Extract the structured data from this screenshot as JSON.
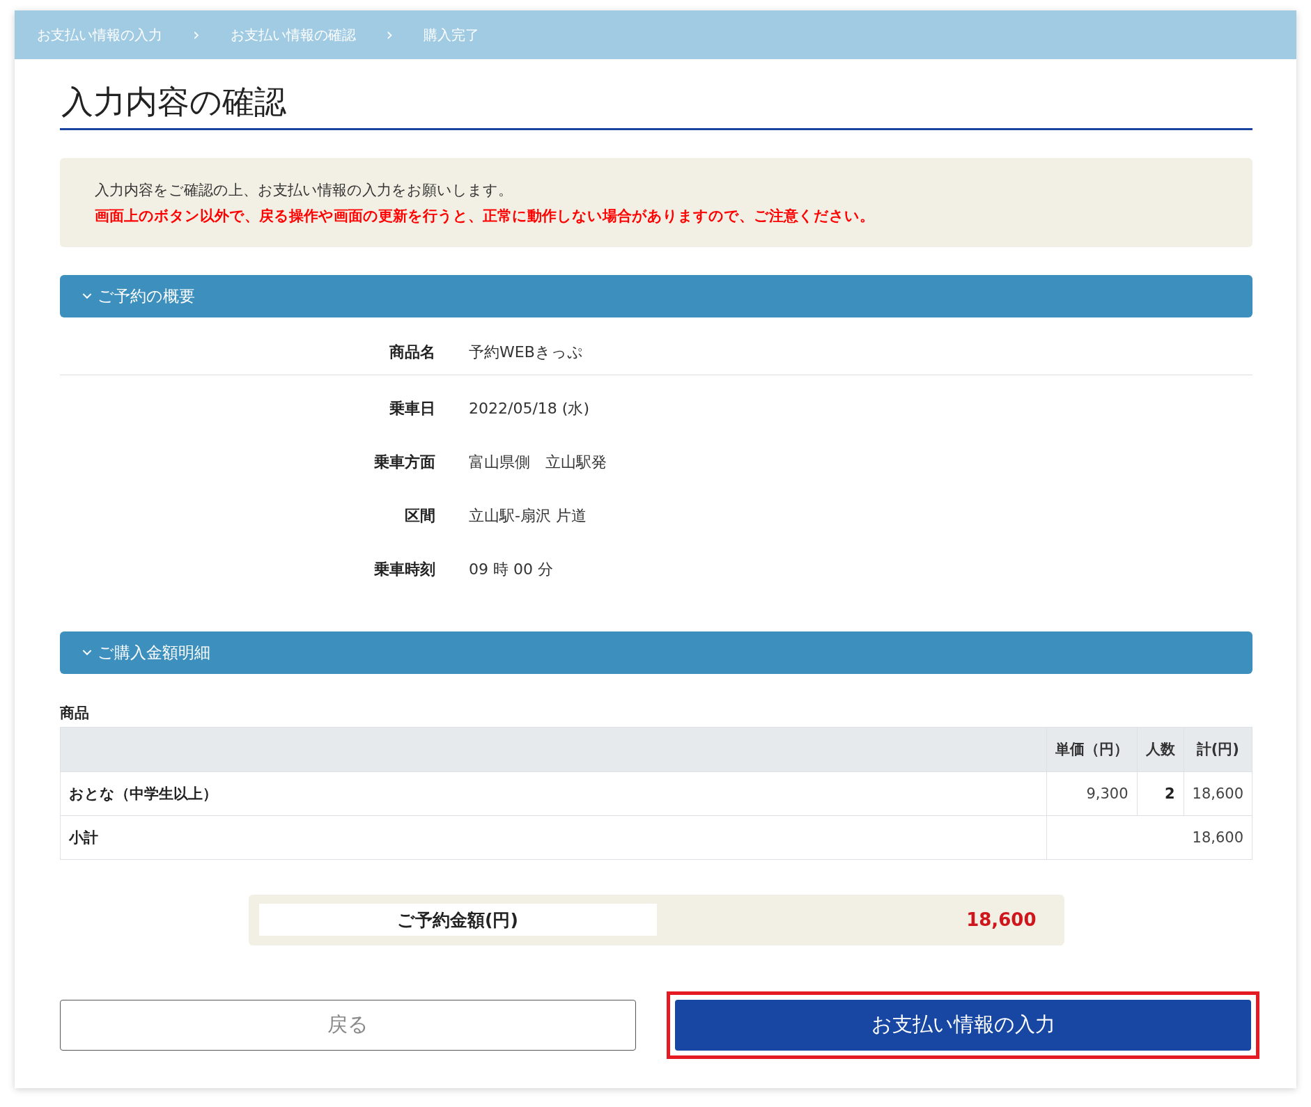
{
  "breadcrumb": [
    {
      "label": "お支払い情報の入力",
      "separator": "›"
    },
    {
      "label": "お支払い情報の確認",
      "separator": "›"
    },
    {
      "label": "購入完了"
    }
  ],
  "title": "入力内容の確認",
  "notice": {
    "text": "入力内容をご確認の上、お支払い情報の入力をお願いします。",
    "warning": "画面上のボタン以外で、戻る操作や画面の更新を行うと、正常に動作しない場合がありますので、ご注意ください。"
  },
  "summary_section": {
    "title": "ご予約の概要",
    "expanded": true,
    "rows": [
      {
        "label": "商品名",
        "value": "予約WEBきっぷ",
        "divider_after": true
      },
      {
        "label": "乗車日",
        "value": "2022/05/18 (水)",
        "divider_after": false
      },
      {
        "label": "乗車方面",
        "value": "富山県側　立山駅発",
        "divider_after": false
      },
      {
        "label": "区間",
        "value": "立山駅-扇沢 片道",
        "divider_after": false
      },
      {
        "label": "乗車時刻",
        "value": "09 時 00 分",
        "divider_after": false
      }
    ]
  },
  "price_section": {
    "title": "ご購入金額明細",
    "expanded": true,
    "table_caption": "商品",
    "table": {
      "columns": [
        "単価（円）",
        "人数",
        "計(円)"
      ],
      "rows": [
        {
          "kind": "item",
          "name": "おとな（中学生以上）",
          "unit_price": "9,300",
          "count": "2",
          "total": "18,600"
        },
        {
          "kind": "subtotal",
          "name": "小計",
          "total": "18,600"
        }
      ]
    }
  },
  "reservation_total": {
    "label": "ご予約金額(円)",
    "value": "18,600"
  },
  "buttons": [
    {
      "kind": "secondary",
      "label": "戻る",
      "highlighted": false
    },
    {
      "kind": "primary",
      "label": "お支払い情報の入力",
      "highlighted": true
    }
  ]
}
